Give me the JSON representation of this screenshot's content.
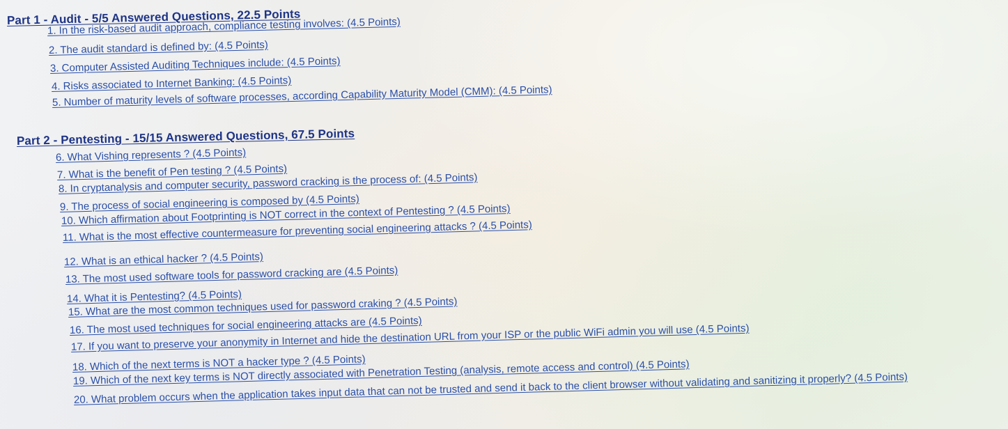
{
  "parts": [
    {
      "title": "Part 1 - Audit - 5/5 Answered Questions, 22.5 Points",
      "questions": [
        "1. In the risk-based audit approach, compliance testing involves: (4.5 Points)",
        "2. The audit standard is defined by: (4.5 Points)",
        "3. Computer Assisted Auditing Techniques include: (4.5 Points)",
        "4. Risks associated to Internet Banking: (4.5 Points)",
        "5. Number of maturity levels of software processes, according Capability Maturity Model (CMM): (4.5 Points)"
      ]
    },
    {
      "title": "Part 2 - Pentesting - 15/15 Answered Questions, 67.5 Points",
      "questions": [
        "6. What Vishing represents ? (4.5 Points)",
        "7. What is the benefit of Pen testing ? (4.5 Points)",
        "8. In cryptanalysis and computer security, password cracking is the process of: (4.5 Points)",
        "9. The process of social engineering is composed by (4.5 Points)",
        "10. Which affirmation about Footprinting is NOT correct in the context of Pentesting ? (4.5 Points)",
        "11. What is the most effective countermeasure for preventing social engineering attacks ? (4.5 Points)",
        "12. What is an ethical hacker ? (4.5 Points)",
        "13. The most used software tools for password cracking are (4.5 Points)",
        "14. What it is Pentesting? (4.5 Points)",
        "15. What are the most common techniques used for password craking ? (4.5 Points)",
        "16. The most used techniques for social engineering attacks are (4.5 Points)",
        "17. If you want to preserve your anonymity in Internet and hide the destination URL from your ISP or the public WiFi admin you will use (4.5 Points)",
        "18. Which of the next terms is NOT a hacker type ? (4.5 Points)",
        "19. Which of the next key terms is NOT directly associated with Penetration Testing (analysis, remote access and control) (4.5 Points)",
        "20. What problem occurs when the application takes input data that can not be trusted and send it back to the client browser without validating and sanitizing it properly? (4.5 Points)"
      ]
    }
  ]
}
